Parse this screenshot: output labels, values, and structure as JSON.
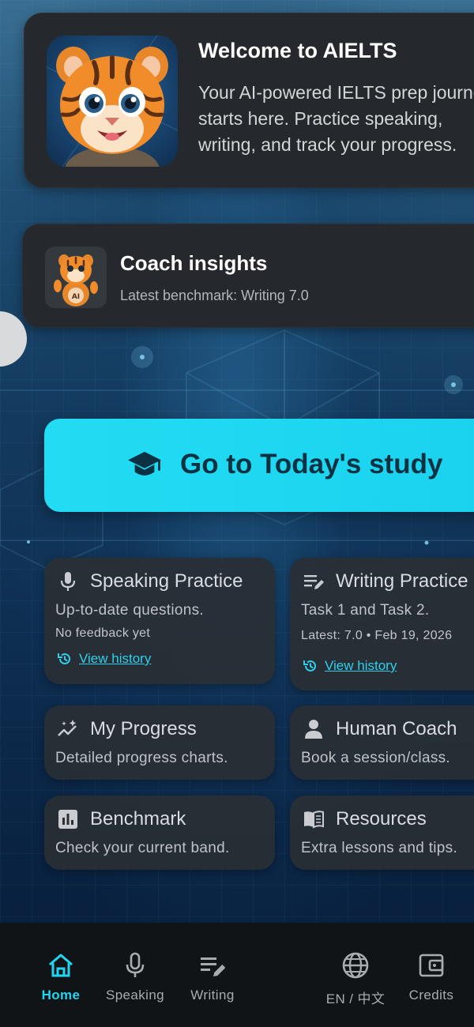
{
  "welcome": {
    "title": "Welcome to AIELTS",
    "text": "Your AI-powered IELTS prep journey\nstarts here. Practice speaking,\nwriting, and track your progress."
  },
  "coach_insights": {
    "title": "Coach insights",
    "subtitle": "Latest benchmark: Writing 7.0"
  },
  "study_button": {
    "label": "Go to Today's study",
    "icon": "graduation-cap-icon"
  },
  "tiles": {
    "speaking": {
      "title": "Speaking Practice",
      "description": "Up-to-date questions.",
      "status": "No feedback yet",
      "history_link": "View history",
      "icon": "microphone-icon"
    },
    "writing": {
      "title": "Writing Practice",
      "description": "Task 1 and Task 2.",
      "status": "Latest: 7.0 • Feb 19, 2026",
      "history_link": "View history",
      "icon": "writing-icon"
    },
    "progress": {
      "title": "My Progress",
      "description": "Detailed progress charts.",
      "icon": "sparkle-chart-icon"
    },
    "human_coach": {
      "title": "Human Coach",
      "description": "Book a session/class.",
      "icon": "person-icon"
    },
    "benchmark": {
      "title": "Benchmark",
      "description": "Check your current band.",
      "icon": "bar-chart-icon"
    },
    "resources": {
      "title": "Resources",
      "description": "Extra lessons and tips.",
      "icon": "book-icon"
    }
  },
  "bottom_nav": {
    "active": "Home",
    "items": [
      {
        "label": "Home",
        "icon": "home-icon"
      },
      {
        "label": "Speaking",
        "icon": "microphone-icon"
      },
      {
        "label": "Writing",
        "icon": "writing-icon"
      },
      {
        "label": "EN / 中文",
        "icon": "globe-icon"
      },
      {
        "label": "Credits",
        "icon": "wallet-icon"
      }
    ]
  },
  "colors": {
    "accent": "#22d4ef",
    "card": "#25292d",
    "nav_background": "#111416",
    "button_text": "#0b3142"
  }
}
